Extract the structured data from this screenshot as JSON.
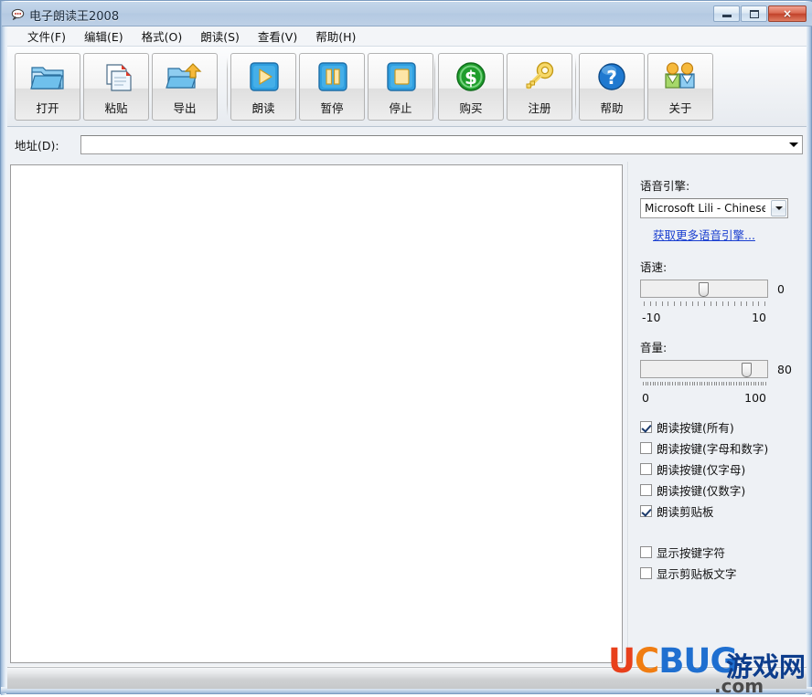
{
  "window": {
    "title": "电子朗读王2008",
    "icon": "speech-bubble-icon",
    "controls": {
      "minimize": "最小化",
      "maximize": "最大化",
      "close": "×"
    }
  },
  "menubar": {
    "items": [
      {
        "label": "文件(F)",
        "name": "menu-file"
      },
      {
        "label": "编辑(E)",
        "name": "menu-edit"
      },
      {
        "label": "格式(O)",
        "name": "menu-format"
      },
      {
        "label": "朗读(S)",
        "name": "menu-speak"
      },
      {
        "label": "查看(V)",
        "name": "menu-view"
      },
      {
        "label": "帮助(H)",
        "name": "menu-help"
      }
    ]
  },
  "toolbar": {
    "group1": [
      {
        "label": "打开",
        "icon": "open-folder-icon",
        "name": "toolbar-open"
      },
      {
        "label": "粘贴",
        "icon": "paste-icon",
        "name": "toolbar-paste"
      },
      {
        "label": "导出",
        "icon": "export-icon",
        "name": "toolbar-export"
      }
    ],
    "group2": [
      {
        "label": "朗读",
        "icon": "play-icon",
        "name": "toolbar-play"
      },
      {
        "label": "暂停",
        "icon": "pause-icon",
        "name": "toolbar-pause"
      },
      {
        "label": "停止",
        "icon": "stop-icon",
        "name": "toolbar-stop"
      }
    ],
    "group3": [
      {
        "label": "购买",
        "icon": "dollar-icon",
        "name": "toolbar-buy"
      },
      {
        "label": "注册",
        "icon": "key-icon",
        "name": "toolbar-register"
      }
    ],
    "group4": [
      {
        "label": "帮助",
        "icon": "question-icon",
        "name": "toolbar-help"
      },
      {
        "label": "关于",
        "icon": "people-icon",
        "name": "toolbar-about"
      }
    ]
  },
  "address": {
    "label": "地址(D):",
    "value": "",
    "placeholder": ""
  },
  "editor": {
    "value": "",
    "placeholder": ""
  },
  "panel": {
    "engine": {
      "label": "语音引擎:",
      "selected": "Microsoft Lili - Chinese (Chin",
      "more_link": "获取更多语音引擎..."
    },
    "rate": {
      "label": "语速:",
      "value": "0",
      "min": "-10",
      "max": "10"
    },
    "volume": {
      "label": "音量:",
      "value": "80",
      "min": "0",
      "max": "100"
    },
    "checkboxes": [
      {
        "label": "朗读按键(所有)",
        "checked": true,
        "name": "checkbox-speak-keys-all"
      },
      {
        "label": "朗读按键(字母和数字)",
        "checked": false,
        "name": "checkbox-speak-keys-alnum"
      },
      {
        "label": "朗读按键(仅字母)",
        "checked": false,
        "name": "checkbox-speak-keys-letters"
      },
      {
        "label": "朗读按键(仅数字)",
        "checked": false,
        "name": "checkbox-speak-keys-digits"
      },
      {
        "label": "朗读剪贴板",
        "checked": true,
        "name": "checkbox-speak-clipboard"
      }
    ],
    "display_checkboxes": [
      {
        "label": "显示按键字符",
        "checked": false,
        "name": "checkbox-show-key-chars"
      },
      {
        "label": "显示剪贴板文字",
        "checked": false,
        "name": "checkbox-show-clipboard-text"
      }
    ]
  },
  "watermark": {
    "part_u": "U",
    "part_c": "C",
    "part_bug": "BUG",
    "chinese": "游戏网",
    "domain": ".com"
  },
  "colors": {
    "titlebar": "#b9cde4",
    "close_button": "#c1422a",
    "link": "#1a3fd0",
    "panel_bg": "#eef1f5",
    "editor_bg": "#ffffff"
  }
}
